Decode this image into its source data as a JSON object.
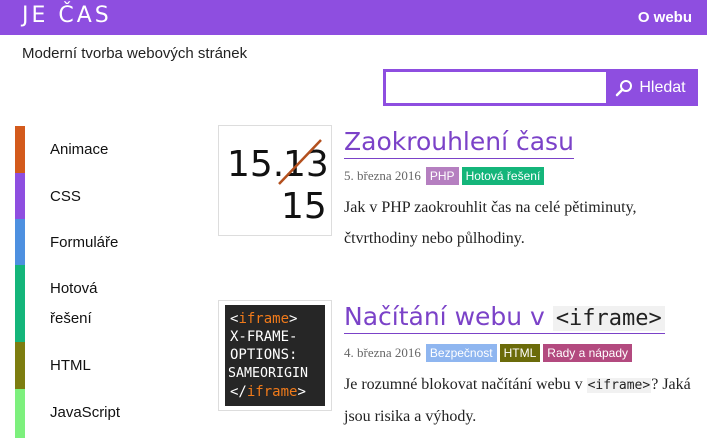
{
  "header": {
    "logo": "JE ČAS",
    "about_link": "O webu",
    "tagline": "Moderní tvorba webových stránek",
    "bg_color": "#8e4ee0"
  },
  "search": {
    "value": "",
    "placeholder": "",
    "button_label": "Hledat",
    "button_icon": "magnifier-icon"
  },
  "sidebar": {
    "items": [
      {
        "label": "Animace",
        "color": "#d35a1c"
      },
      {
        "label": "CSS",
        "color": "#8e4ee0"
      },
      {
        "label": "Formuláře",
        "color": "#4d90e0"
      },
      {
        "label": "Hotová řešení",
        "label_line1": "Hotová",
        "label_line2": "řešení",
        "color": "#14b57a"
      },
      {
        "label": "HTML",
        "color": "#7d7d10"
      },
      {
        "label": "JavaScript",
        "color": "#7df07d"
      }
    ]
  },
  "articles": [
    {
      "title": "Zaokrouhlení času",
      "date": "5. března 2016",
      "tags": [
        {
          "label": "PHP",
          "color": "#b57fc0"
        },
        {
          "label": "Hotová řešení",
          "color": "#14b57a"
        }
      ],
      "description": "Jak v PHP zaokrouhlit čas na celé pětiminuty, čtvrthodiny nebo půlhodiny.",
      "thumb": {
        "old_value": "15.13",
        "new_value": "15",
        "prefix": "15.",
        "struck": "13"
      }
    },
    {
      "title_prefix": "Načítání webu v",
      "title_code": "<iframe>",
      "date": "4. března 2016",
      "tags": [
        {
          "label": "Bezpečnost",
          "color": "#8fb6f0"
        },
        {
          "label": "HTML",
          "color": "#6b6b0a"
        },
        {
          "label": "Rady a nápady",
          "color": "#b34a7f"
        }
      ],
      "description_prefix": "Je rozumné blokovat načítání webu v",
      "description_code": "<iframe>",
      "description_suffix": "? Jaká jsou risika a výhody.",
      "thumb": {
        "line1_open": "<",
        "line1_tag": "iframe",
        "line1_close": ">",
        "line2": "X-FRAME-",
        "line3": "OPTIONS:",
        "line4": "SAMEORIGIN",
        "line5_open": "</",
        "line5_tag": "iframe",
        "line5_close": ">"
      }
    }
  ]
}
